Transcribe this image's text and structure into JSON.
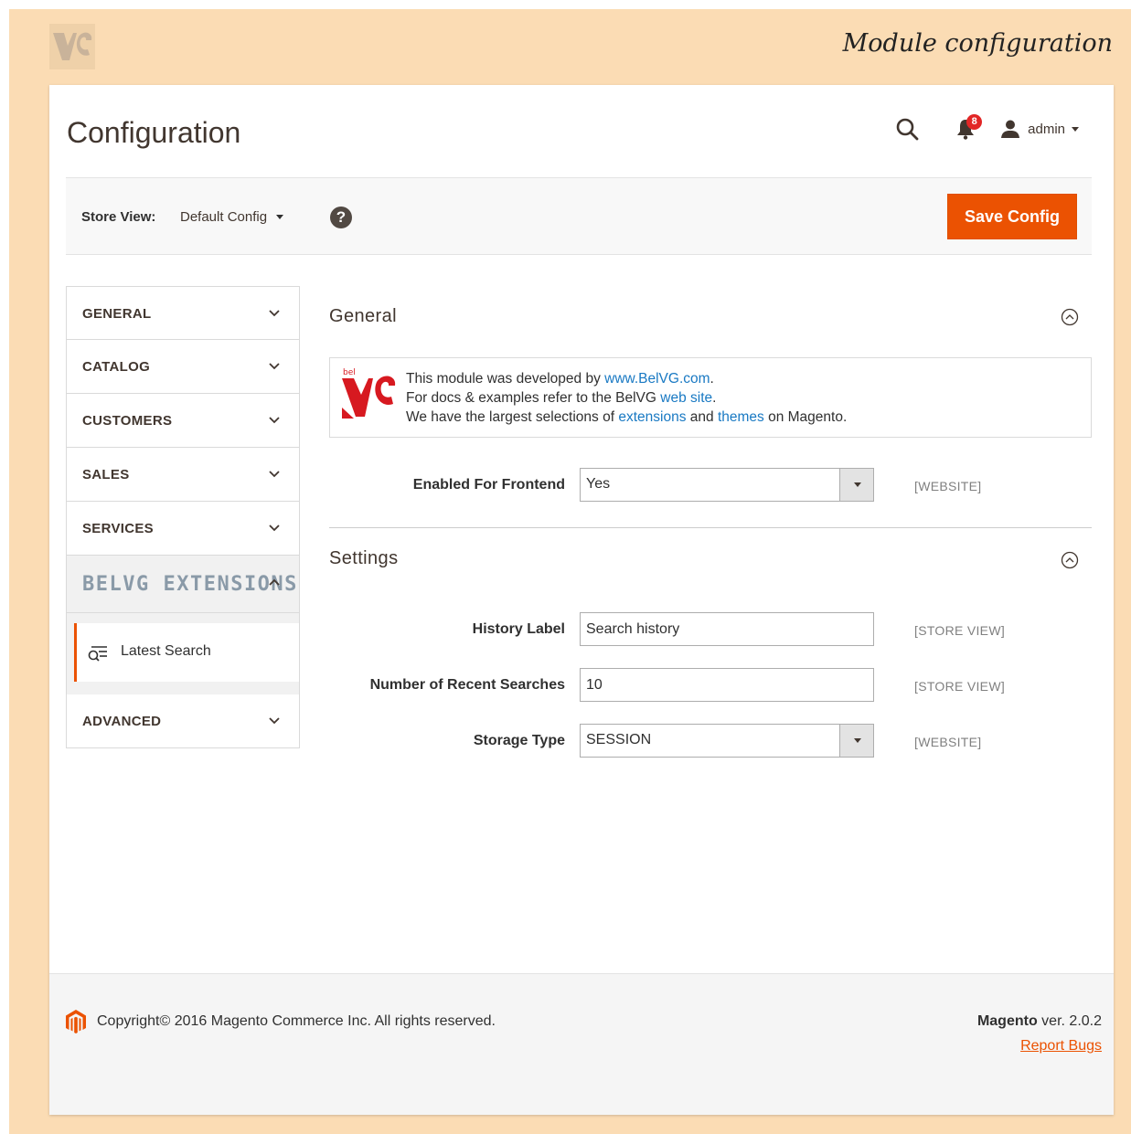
{
  "banner": {
    "title": "Module configuration",
    "logo_icon": "belvg-logo-icon"
  },
  "header": {
    "page_title": "Configuration",
    "notifications_count": "8",
    "user_name": "admin"
  },
  "store_bar": {
    "label": "Store View:",
    "selected": "Default Config",
    "help_glyph": "?",
    "save_label": "Save Config"
  },
  "sidebar": {
    "items": [
      {
        "label": "GENERAL"
      },
      {
        "label": "CATALOG"
      },
      {
        "label": "CUSTOMERS"
      },
      {
        "label": "SALES"
      },
      {
        "label": "SERVICES"
      },
      {
        "label": "BELVG EXTENSIONS"
      },
      {
        "label": "ADVANCED"
      }
    ],
    "sub_item": "Latest Search"
  },
  "general": {
    "title": "General",
    "info": {
      "l1_pre": "This module was developed by ",
      "l1_link": "www.BelVG.com",
      "l1_post": ".",
      "l2_pre": "For docs & examples refer to the BelVG ",
      "l2_link": "web site",
      "l2_post": ".",
      "l3_pre": "We have the largest selections of ",
      "l3_link1": "extensions",
      "l3_mid": " and ",
      "l3_link2": "themes",
      "l3_post": " on Magento."
    },
    "enabled_label": "Enabled For Frontend",
    "enabled_value": "Yes",
    "enabled_scope": "[WEBSITE]"
  },
  "settings": {
    "title": "Settings",
    "history_label": "History Label",
    "history_value": "Search history",
    "history_scope": "[STORE VIEW]",
    "recent_label": "Number of Recent Searches",
    "recent_value": "10",
    "recent_scope": "[STORE VIEW]",
    "storage_label": "Storage Type",
    "storage_value": "SESSION",
    "storage_scope": "[WEBSITE]"
  },
  "footer": {
    "copyright": "Copyright© 2016 Magento Commerce Inc. All rights reserved.",
    "brand": "Magento",
    "version": " ver. 2.0.2",
    "report": "Report Bugs"
  },
  "colors": {
    "accent": "#eb5202",
    "link": "#1979c3",
    "badge": "#e22626",
    "banner": "#fbdcb4"
  }
}
